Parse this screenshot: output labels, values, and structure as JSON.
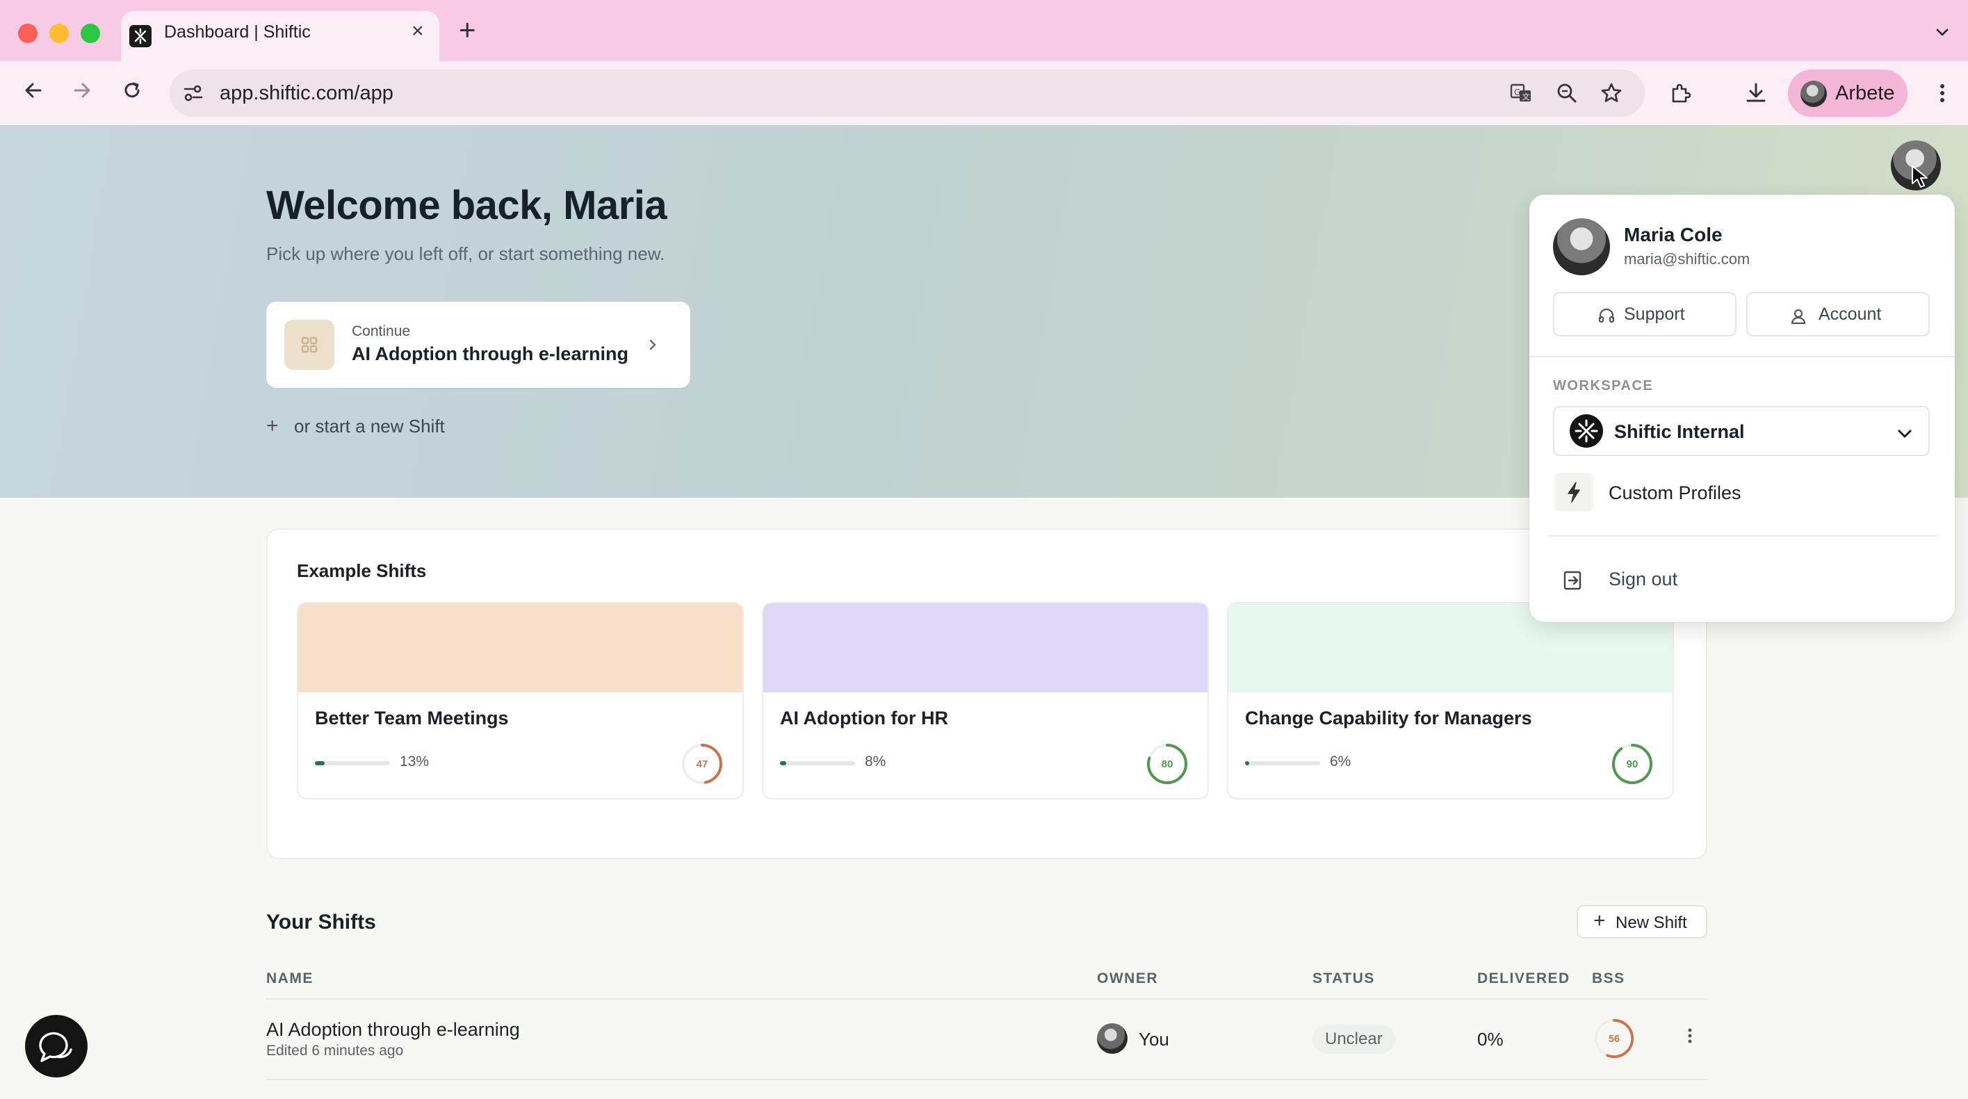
{
  "browser": {
    "tab_title": "Dashboard | Shiftic",
    "url": "app.shiftic.com/app",
    "profile_name": "Arbete"
  },
  "hero": {
    "title": "Welcome back, Maria",
    "subtitle": "Pick up where you left off, or start something new.",
    "continue_label": "Continue",
    "continue_name": "AI Adoption through e-learning",
    "new_shift_link": "or start a new Shift"
  },
  "examples": {
    "title": "Example Shifts",
    "cards": [
      {
        "title": "Better Team Meetings",
        "progress_pct": 13,
        "progress_label": "13%",
        "score": "47",
        "score_value": 47,
        "band_color": "#f8dfca",
        "ring_color": "#c9744a"
      },
      {
        "title": "AI Adoption for HR",
        "progress_pct": 8,
        "progress_label": "8%",
        "score": "80",
        "score_value": 80,
        "band_color": "#ded8f6",
        "ring_color": "#4e9a4e"
      },
      {
        "title": "Change Capability for Managers",
        "progress_pct": 6,
        "progress_label": "6%",
        "score": "90",
        "score_value": 90,
        "band_color": "#e7f8f0",
        "ring_color": "#4e9a4e"
      }
    ]
  },
  "your_shifts": {
    "title": "Your Shifts",
    "new_button": "New Shift",
    "columns": [
      "NAME",
      "OWNER",
      "STATUS",
      "DELIVERED",
      "BSS"
    ],
    "rows": [
      {
        "name": "AI Adoption through e-learning",
        "edited": "Edited 6 minutes ago",
        "owner": "You",
        "status": "Unclear",
        "delivered": "0%",
        "bss": "56",
        "bss_value": 56,
        "ring_color": "#c9744a"
      }
    ]
  },
  "account_menu": {
    "name": "Maria Cole",
    "email": "maria@shiftic.com",
    "support_label": "Support",
    "account_label": "Account",
    "workspace_label": "WORKSPACE",
    "workspace_name": "Shiftic Internal",
    "custom_profiles_label": "Custom Profiles",
    "sign_out_label": "Sign out"
  },
  "colors": {
    "accent_green": "#2f6e57",
    "tab_strip": "#f6cbe3"
  }
}
